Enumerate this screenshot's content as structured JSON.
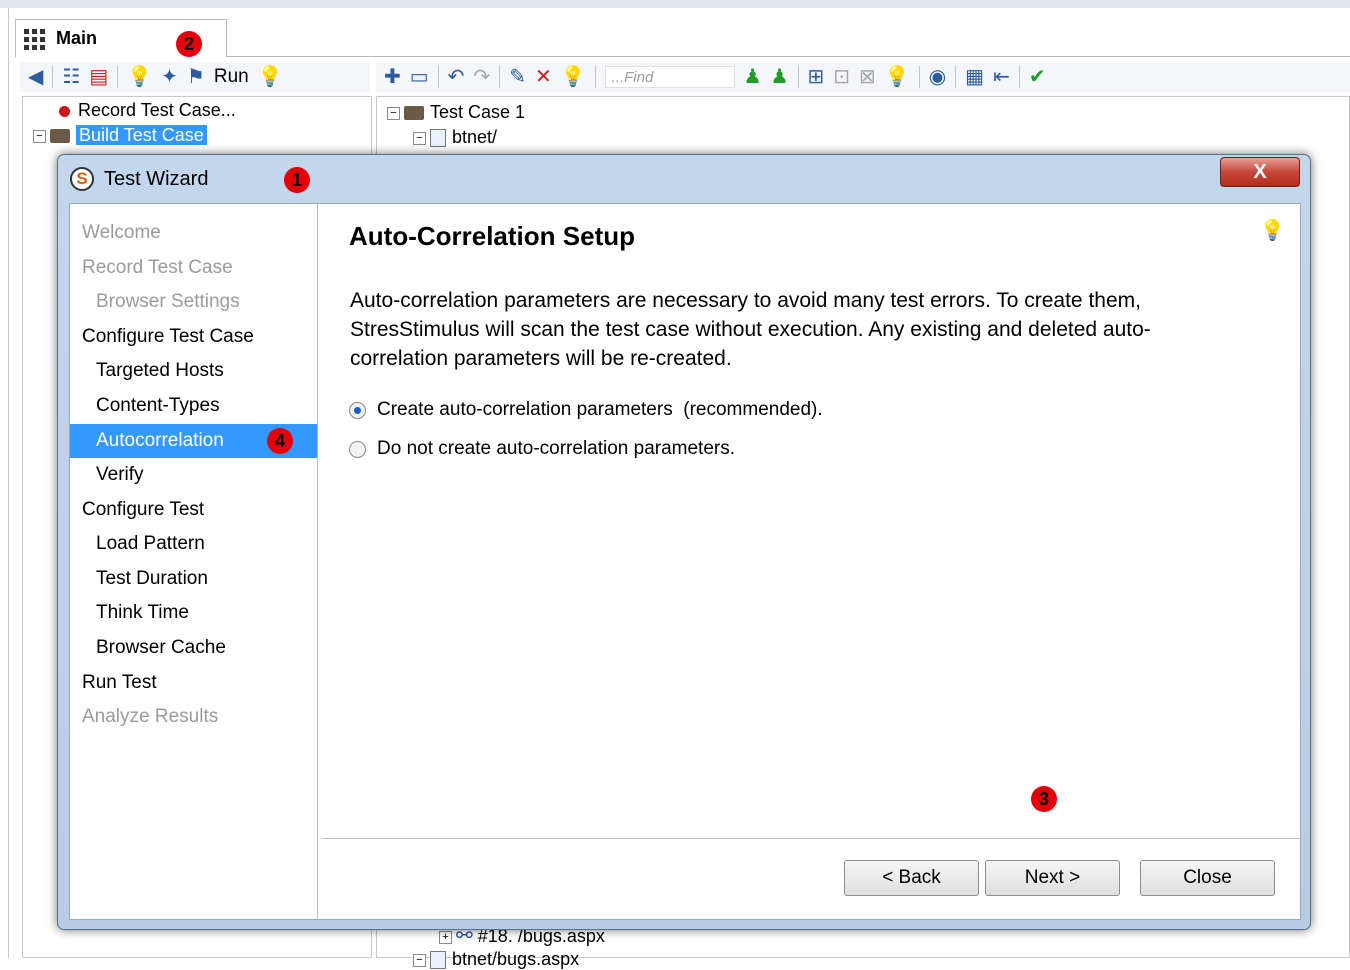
{
  "app": {
    "main_tab_label": "Main",
    "left_toolbar": {
      "run_label": "Run"
    },
    "right_toolbar": {
      "find_placeholder": "...Find"
    },
    "left_tree": [
      {
        "label": "Record Test Case..."
      },
      {
        "label": "Build Test Case",
        "selected": true
      }
    ],
    "right_tree": [
      {
        "label": "Test Case 1"
      },
      {
        "label": "btnet/"
      },
      {
        "label": "#18. /bugs.aspx"
      },
      {
        "label": "btnet/bugs.aspx"
      }
    ]
  },
  "annotations": [
    "1",
    "2",
    "3",
    "4"
  ],
  "dialog": {
    "title": "Test Wizard",
    "close_glyph": "X",
    "nav": [
      {
        "label": "Welcome",
        "level": 1,
        "state": "disabled"
      },
      {
        "label": "Record Test Case",
        "level": 1,
        "state": "disabled"
      },
      {
        "label": "Browser Settings",
        "level": 2,
        "state": "disabled"
      },
      {
        "label": "Configure Test Case",
        "level": 1,
        "state": "normal"
      },
      {
        "label": "Targeted Hosts",
        "level": 2,
        "state": "normal"
      },
      {
        "label": "Content-Types",
        "level": 2,
        "state": "normal"
      },
      {
        "label": "Autocorrelation",
        "level": 2,
        "state": "selected"
      },
      {
        "label": "Verify",
        "level": 2,
        "state": "normal"
      },
      {
        "label": "Configure Test",
        "level": 1,
        "state": "normal"
      },
      {
        "label": "Load Pattern",
        "level": 2,
        "state": "normal"
      },
      {
        "label": "Test Duration",
        "level": 2,
        "state": "normal"
      },
      {
        "label": "Think Time",
        "level": 2,
        "state": "normal"
      },
      {
        "label": "Browser Cache",
        "level": 2,
        "state": "normal"
      },
      {
        "label": "Run Test",
        "level": 1,
        "state": "normal"
      },
      {
        "label": "Analyze Results",
        "level": 1,
        "state": "disabled"
      }
    ],
    "heading": "Auto-Correlation Setup",
    "description": "Auto-correlation parameters are necessary to avoid many test errors. To create them, StresStimulus will scan the test case without execution. Any existing and deleted auto-correlation parameters will be re-created.",
    "options": [
      {
        "label": "Create auto-correlation parameters  (recommended).",
        "checked": true
      },
      {
        "label": "Do not create auto-correlation parameters.",
        "checked": false
      }
    ],
    "buttons": {
      "back": "< Back",
      "next": "Next >",
      "close": "Close"
    }
  }
}
